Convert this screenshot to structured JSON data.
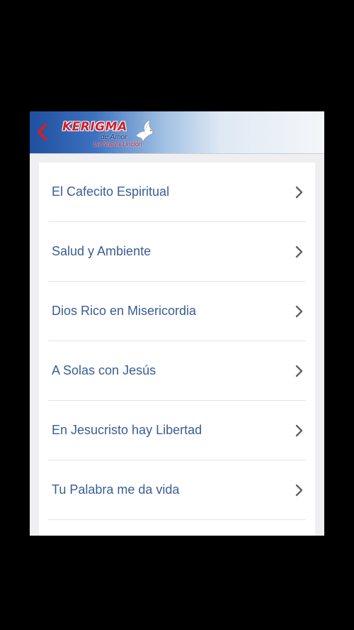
{
  "header": {
    "logo": {
      "title": "KERIGMA",
      "line1": "de Amor",
      "line2": "La Nueva Unción"
    },
    "back_icon": "chevron-left-icon",
    "colors": {
      "back": "#d41f26",
      "brand_blue": "#1f4fa0"
    }
  },
  "list": {
    "items": [
      {
        "label": "El Cafecito Espiritual"
      },
      {
        "label": "Salud y Ambiente"
      },
      {
        "label": "Dios Rico en Misericordia"
      },
      {
        "label": "A Solas con Jesús"
      },
      {
        "label": "En Jesucristo hay Libertad"
      },
      {
        "label": "Tu Palabra me da vida"
      }
    ],
    "chevron_icon": "chevron-right-icon",
    "colors": {
      "label": "#3a5d94",
      "chevron": "#5f6368"
    }
  }
}
